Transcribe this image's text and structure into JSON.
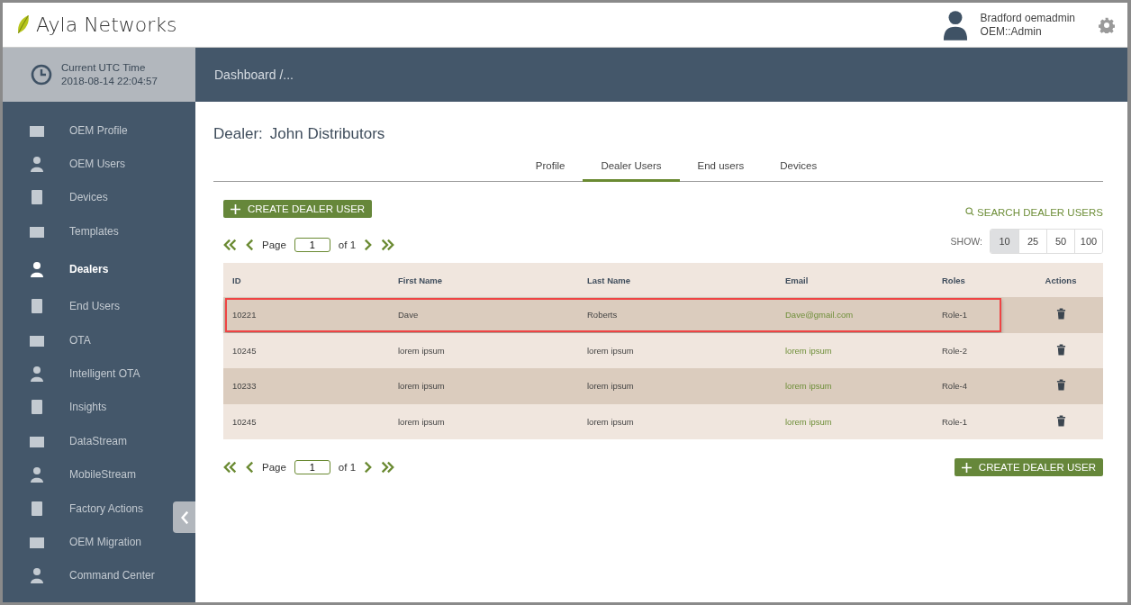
{
  "header": {
    "brand": "Ayla Networks",
    "user_name": "Bradford oemadmin",
    "user_role": "OEM::Admin"
  },
  "clock": {
    "label": "Current UTC Time",
    "value": "2018-08-14 22:04:57"
  },
  "breadcrumb": "Dashboard /...",
  "sidebar": {
    "items": [
      {
        "label": "OEM Profile",
        "selected": false
      },
      {
        "label": "OEM Users",
        "selected": false
      },
      {
        "label": "Devices",
        "selected": false
      },
      {
        "label": "Templates",
        "selected": false
      },
      {
        "label": "Dealers",
        "selected": true
      },
      {
        "label": "End Users",
        "selected": false
      },
      {
        "label": "OTA",
        "selected": false
      },
      {
        "label": "Intelligent OTA",
        "selected": false
      },
      {
        "label": "Insights",
        "selected": false
      },
      {
        "label": "DataStream",
        "selected": false
      },
      {
        "label": "MobileStream",
        "selected": false
      },
      {
        "label": "Factory Actions",
        "selected": false
      },
      {
        "label": "OEM Migration",
        "selected": false
      },
      {
        "label": "Command Center",
        "selected": false
      }
    ]
  },
  "page": {
    "title_label": "Dealer:",
    "title_value": "John Distributors"
  },
  "tabs": [
    {
      "label": "Profile",
      "selected": false
    },
    {
      "label": "Dealer Users",
      "selected": true
    },
    {
      "label": "End users",
      "selected": false
    },
    {
      "label": "Devices",
      "selected": false
    }
  ],
  "create_button": "CREATE DEALER USER",
  "search_link": "SEARCH DEALER USERS",
  "pagination": {
    "page_label": "Page",
    "page_value": "1",
    "of_label": "of 1"
  },
  "show": {
    "label": "SHOW:",
    "options": [
      {
        "label": "10",
        "selected": true
      },
      {
        "label": "25",
        "selected": false
      },
      {
        "label": "50",
        "selected": false
      },
      {
        "label": "100",
        "selected": false
      }
    ]
  },
  "table": {
    "columns": [
      "ID",
      "First Name",
      "Last Name",
      "Email",
      "Roles",
      "Actions"
    ],
    "rows": [
      {
        "id": "10221",
        "first_name": "Dave",
        "last_name": "Roberts",
        "email": "Dave@gmail.com",
        "role": "Role-1",
        "highlighted": true
      },
      {
        "id": "10245",
        "first_name": "lorem ipsum",
        "last_name": "lorem ipsum",
        "email": "lorem ipsum",
        "role": "Role-2",
        "highlighted": false
      },
      {
        "id": "10233",
        "first_name": "lorem ipsum",
        "last_name": "lorem ipsum",
        "email": "lorem ipsum",
        "role": "Role-4",
        "highlighted": false
      },
      {
        "id": "10245",
        "first_name": "lorem ipsum",
        "last_name": "lorem ipsum",
        "email": "lorem ipsum",
        "role": "Role-1",
        "highlighted": false
      }
    ]
  },
  "bottom_pagination": {
    "page_label": "Page",
    "page_value": "1",
    "of_label": "of 1"
  },
  "bottom_create_button": "CREATE DEALER USER"
}
